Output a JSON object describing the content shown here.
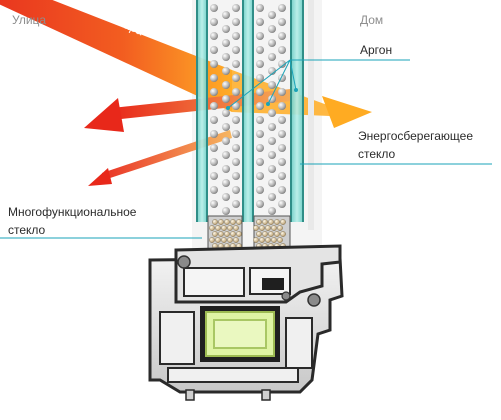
{
  "labels": {
    "street": "Улица",
    "home": "Дом",
    "heat": "жара",
    "argon": "Аргон",
    "energy_glass_line1": "Энергосберегающее",
    "energy_glass_line2": "стекло",
    "multi_glass_line1": "Многофункциональное",
    "multi_glass_line2": "стекло"
  },
  "colors": {
    "heat_arrow": "#ee3a1c",
    "heat_arrow_light": "#ff9a1e",
    "glass": "#7fd8d0",
    "pointer_line": "#1aa3b8",
    "frame": "#d9d9d9",
    "frame_dark": "#2a2a2a",
    "reinforcement": "#d8ef9a",
    "gasket": "#555555"
  },
  "icons": {
    "argon_molecule": "argon-dot-icon",
    "desiccant": "desiccant-granules-icon"
  }
}
